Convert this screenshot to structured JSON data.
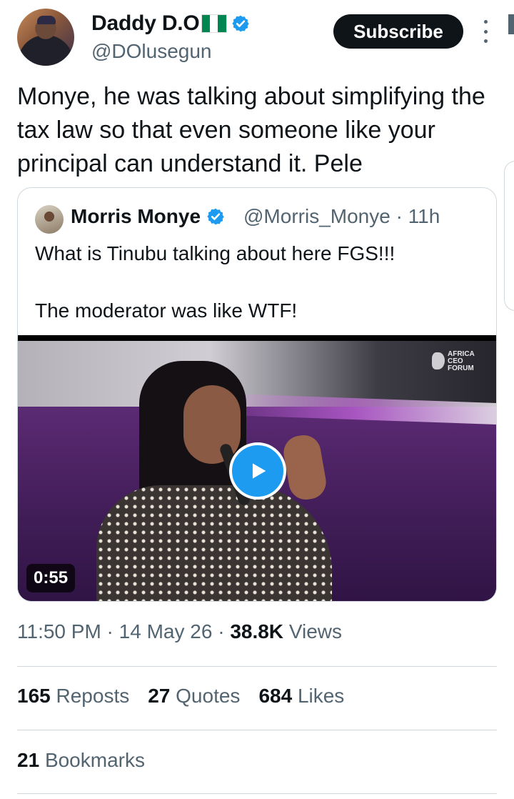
{
  "author": {
    "display_name": "Daddy D.O",
    "handle": "@DOlusegun",
    "flag_icon": "nigeria-flag-icon",
    "verified_icon": "verified-badge-icon"
  },
  "header": {
    "subscribe_label": "Subscribe",
    "more_icon": "more-vertical-icon"
  },
  "tweet": {
    "text": "Monye, he was talking about simplifying the tax law so that even someone like your principal can understand it. Pele"
  },
  "quote": {
    "name": "Morris Monye",
    "handle_time": "@Morris_Monye · 11h",
    "line1": "What is Tinubu talking about here FGS!!!",
    "line2": "The moderator was like WTF!",
    "video": {
      "duration": "0:55",
      "logo_lines": [
        "AFRICA",
        "CEO",
        "FORUM"
      ],
      "play_icon": "play-icon"
    }
  },
  "meta": {
    "time": "11:50 PM",
    "date": "14 May 26",
    "views_count": "38.8K",
    "views_label": "Views"
  },
  "stats": {
    "reposts_count": "165",
    "reposts_label": "Reposts",
    "quotes_count": "27",
    "quotes_label": "Quotes",
    "likes_count": "684",
    "likes_label": "Likes",
    "bookmarks_count": "21",
    "bookmarks_label": "Bookmarks"
  },
  "colors": {
    "accent": "#1d9bf0",
    "text_primary": "#0f1419",
    "text_secondary": "#536471",
    "border": "#cfd9de"
  }
}
